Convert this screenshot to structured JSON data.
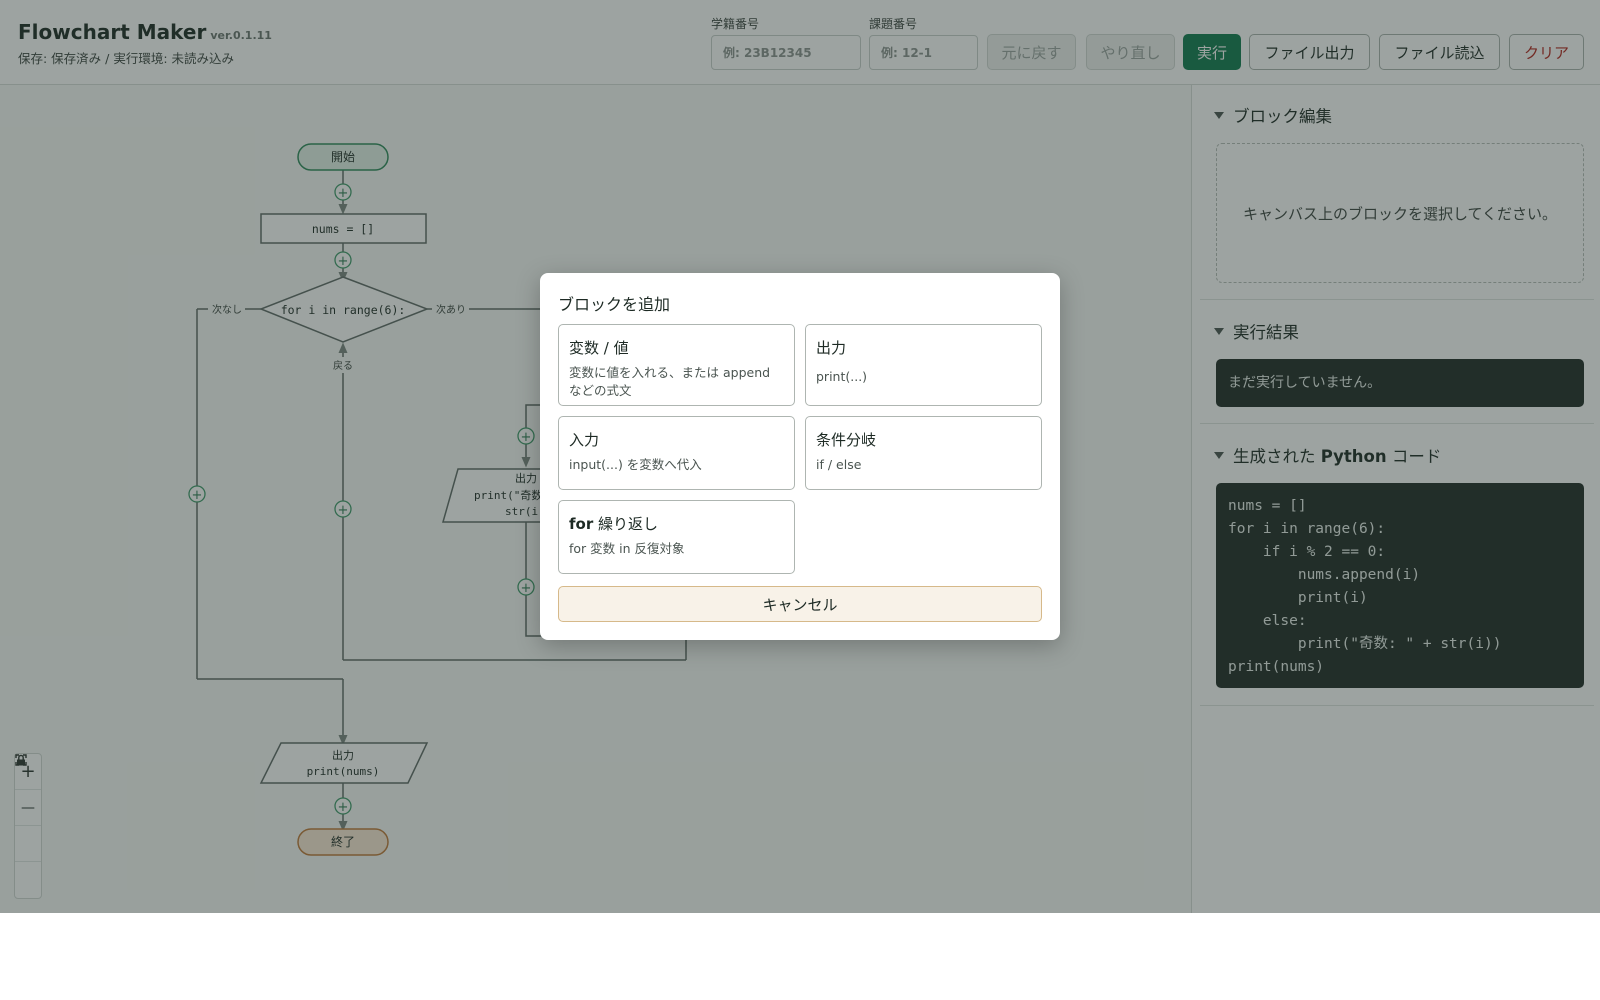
{
  "header": {
    "title": "Flowchart Maker",
    "version": "ver.0.1.11",
    "status": "保存: 保存済み / 実行環境: 未読み込み",
    "student_id_label": "学籍番号",
    "student_id_placeholder": "例: 23B12345",
    "task_id_label": "課題番号",
    "task_id_placeholder": "例: 12-1",
    "buttons": {
      "undo": "元に戻す",
      "redo": "やり直し",
      "run": "実行",
      "export": "ファイル出力",
      "import": "ファイル読込",
      "clear": "クリア"
    }
  },
  "flowchart": {
    "start": "開始",
    "assign": "nums = []",
    "loop": "for i in range(6):",
    "no_next": "次なし",
    "has_next": "次あり",
    "back": "戻る",
    "output_inner_label": "出力",
    "output_inner_line1": "print(\"奇数",
    "output_inner_line2": "str(i",
    "output_final_label": "出力",
    "output_final_code": "print(nums)",
    "end": "終了",
    "add_glyph": "+"
  },
  "zoom_controls": {
    "zoom_in": "+",
    "zoom_out": "—",
    "fit_icon": "fit-screen-icon",
    "lock_icon": "lock-icon"
  },
  "side_panel": {
    "block_edit": {
      "title": "ブロック編集",
      "empty": "キャンバス上のブロックを選択してください。"
    },
    "result": {
      "title": "実行結果",
      "text": "まだ実行していません。"
    },
    "code": {
      "title_prefix": "生成された ",
      "title_strong": "Python",
      "title_suffix": " コード",
      "lines": [
        "nums = []",
        "for i in range(6):",
        "    if i % 2 == 0:",
        "        nums.append(i)",
        "        print(i)",
        "    else:",
        "        print(\"奇数: \" + str(i))",
        "print(nums)"
      ]
    }
  },
  "modal": {
    "title": "ブロックを追加",
    "options": [
      {
        "title": "変数 / 値",
        "desc": "変数に値を入れる、または append などの式文"
      },
      {
        "title": "出力",
        "desc": "print(...)"
      },
      {
        "title": "入力",
        "desc": "input(...) を変数へ代入"
      },
      {
        "title": "条件分岐",
        "desc": "if / else"
      },
      {
        "title_strong": "for",
        "title_rest": " 繰り返し",
        "desc": "for 変数 in 反復対象"
      }
    ],
    "cancel": "キャンセル"
  },
  "colors": {
    "accent": "#0f7a4f",
    "danger": "#b3261e",
    "code_bg": "#1f2b26",
    "start_fill": "#e4f3ea",
    "end_fill": "#fbe9d6"
  }
}
